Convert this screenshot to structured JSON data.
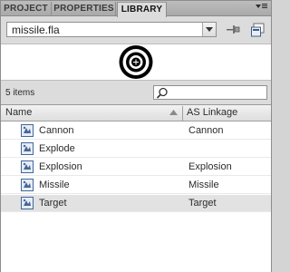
{
  "tabs": [
    {
      "label": "PROJECT",
      "active": false
    },
    {
      "label": "PROPERTIES",
      "active": false
    },
    {
      "label": "LIBRARY",
      "active": true
    }
  ],
  "file_select": {
    "value": "missile.fla"
  },
  "icons": {
    "menu": "panel-menu-icon",
    "pin": "pin-library-icon",
    "new_library": "new-library-panel-icon",
    "preview": "target-symbol-preview",
    "search": "search-icon",
    "sort": "sort-ascending-icon",
    "symbol": "movieclip-symbol-icon"
  },
  "item_count": "5 items",
  "search": {
    "placeholder": ""
  },
  "columns": {
    "name": "Name",
    "linkage": "AS Linkage"
  },
  "rows": [
    {
      "name": "Cannon",
      "linkage": "Cannon",
      "selected": false
    },
    {
      "name": "Explode",
      "linkage": "",
      "selected": false
    },
    {
      "name": "Explosion",
      "linkage": "Explosion",
      "selected": false
    },
    {
      "name": "Missile",
      "linkage": "Missile",
      "selected": false
    },
    {
      "name": "Target",
      "linkage": "Target",
      "selected": true
    }
  ],
  "colors": {
    "selected_row": "#e2e2e2",
    "panel": "#dcdcdc"
  }
}
